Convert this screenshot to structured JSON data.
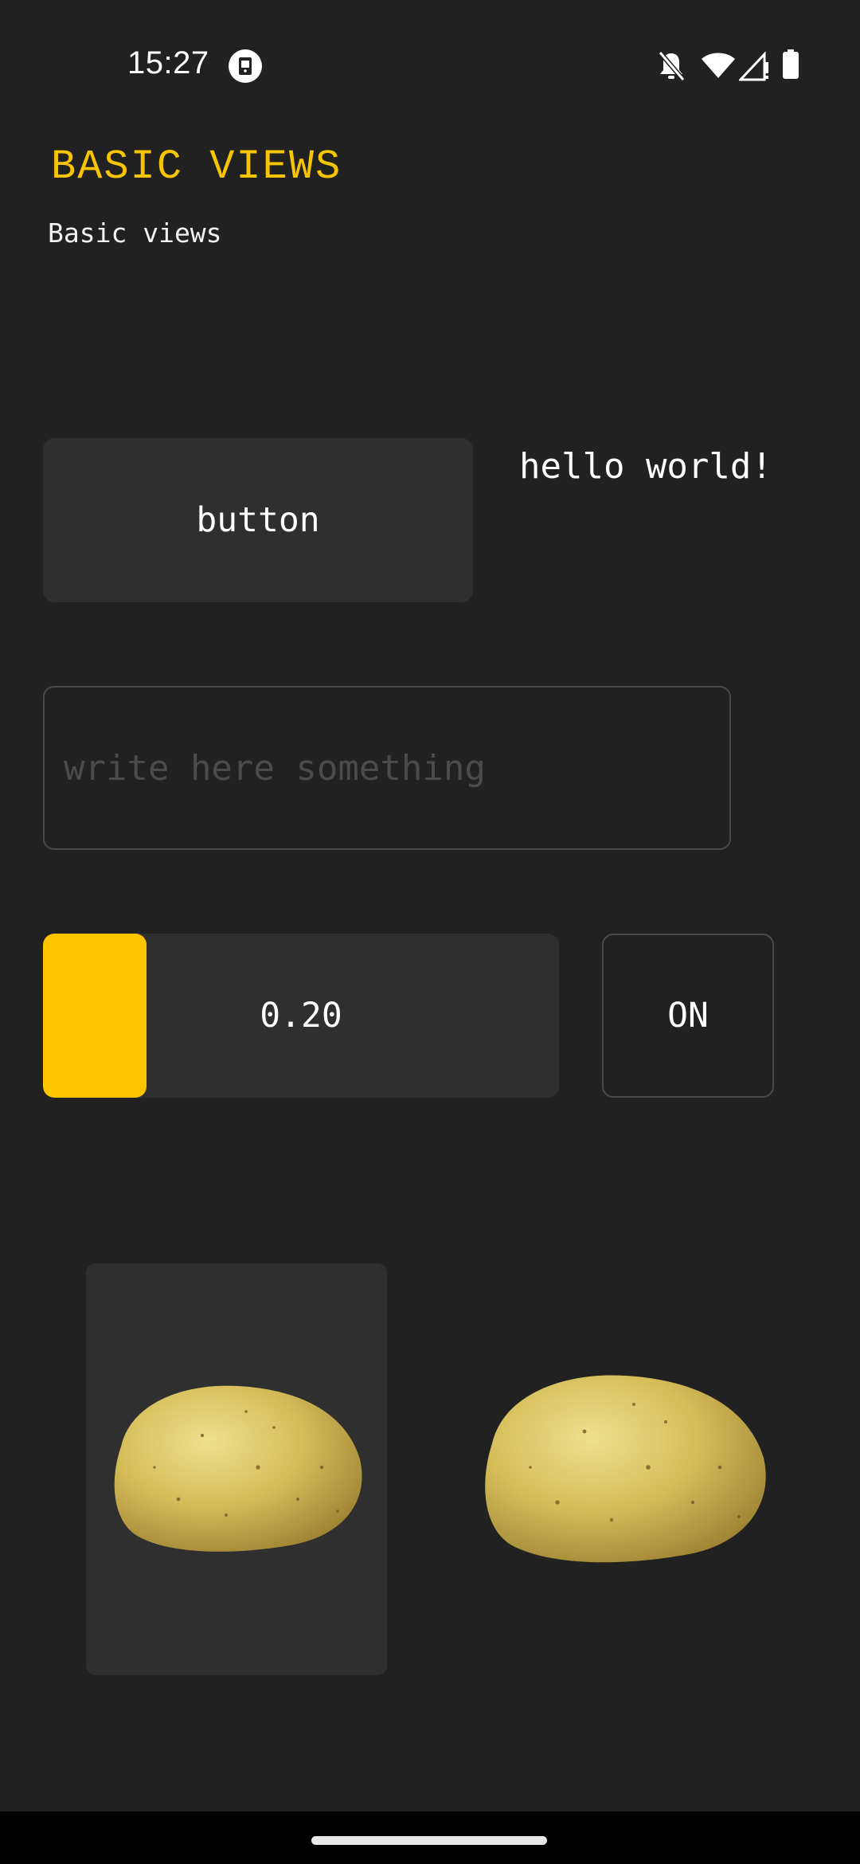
{
  "status_bar": {
    "time": "15:27",
    "icons": [
      "app-notification-icon",
      "notifications-off-icon",
      "wifi-icon",
      "cellular-signal-icon",
      "battery-icon"
    ]
  },
  "page": {
    "title": "BASIC VIEWS",
    "subtitle": "Basic views"
  },
  "controls": {
    "button_label": "button",
    "hello_text": "hello world!",
    "text_field": {
      "value": "",
      "placeholder": "write here something"
    },
    "slider": {
      "value": 0.2,
      "value_label": "0.20"
    },
    "toggle_label": "ON"
  },
  "images": [
    "potato-image",
    "potato-image"
  ],
  "colors": {
    "background": "#212121",
    "surface": "#2f2f2f",
    "accent": "#fdc500",
    "text": "#ffffff",
    "border": "#4a4a4a"
  }
}
